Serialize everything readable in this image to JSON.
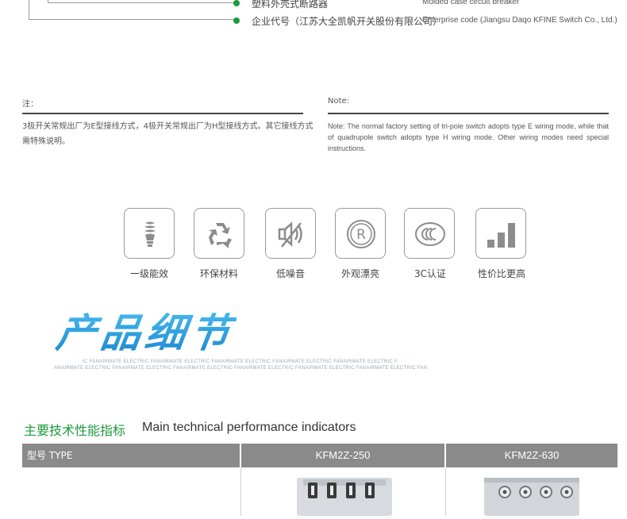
{
  "codes": {
    "rows": [
      {
        "cn": "塑料外壳式断路器",
        "en": "Molded case circuit breaker"
      },
      {
        "cn": "企业代号（江苏大全凯帆开关股份有限公司）",
        "en": "Enterprise code (Jiangsu Daqo KFINE Switch Co., Ltd.)"
      }
    ],
    "accent": "#1d9a3c"
  },
  "notes": {
    "cn_title": "注：",
    "cn_text": "3极开关常规出厂为E型接线方式，4极开关常规出厂为H型接线方式。其它接线方式需特殊说明。",
    "en_title": "Note:",
    "en_text": "Note: The normal factory setting of tri-pole switch adopts type E wiring mode, while that of quadrupole switch adopts type H wiring mode. Other wiring modes need special instructions."
  },
  "features": [
    {
      "icon": "energy-bulb-icon",
      "label": "一级能效"
    },
    {
      "icon": "recycle-icon",
      "label": "环保材料"
    },
    {
      "icon": "mute-speaker-icon",
      "label": "低噪音"
    },
    {
      "icon": "registered-mark-icon",
      "label": "外观漂亮"
    },
    {
      "icon": "ccc-certification-icon",
      "label": "3C认证"
    },
    {
      "icon": "bar-chart-icon",
      "label": "性价比更高"
    }
  ],
  "product_details": {
    "title": "产品细节",
    "sub_line1": "IC FANAIRMATE ELECTRIC FANAIRMATE ELECTRIC FANAIRMATE ELECTRIC FANAIRMATE ELECTRIC FANAIRMATE ELECTRIC F",
    "sub_line2": "ANAIRMATE ELECTRIC FANAIRMATE ELECTRIC FANAIRMATE ELECTRIC FANAIRMATE ELECTRIC FANAIRMATE ELECTRIC FANAIRMATE ELECTRIC FAN"
  },
  "spec": {
    "title_cn": "主要技术性能指标",
    "title_en": "Main technical performance indicators",
    "col_type": "型号   TYPE",
    "col1": "KFM2Z-250",
    "col2": "KFM2Z-630"
  }
}
